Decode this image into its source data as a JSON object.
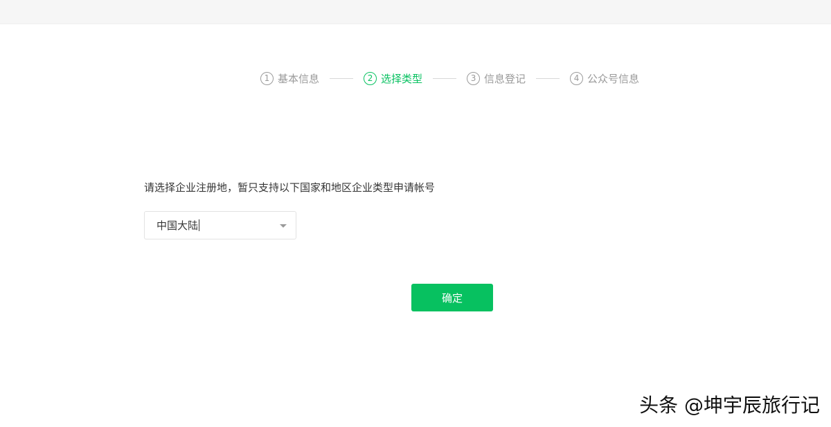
{
  "steps": [
    {
      "num": "1",
      "label": "基本信息",
      "active": false
    },
    {
      "num": "2",
      "label": "选择类型",
      "active": true
    },
    {
      "num": "3",
      "label": "信息登记",
      "active": false
    },
    {
      "num": "4",
      "label": "公众号信息",
      "active": false
    }
  ],
  "form": {
    "prompt": "请选择企业注册地，暂只支持以下国家和地区企业类型申请帐号",
    "region_select_value": "中国大陆",
    "confirm_label": "确定"
  },
  "watermark": {
    "text": "头条 @坤宇辰旅行记"
  },
  "colors": {
    "accent": "#07c160",
    "inactive": "#9a9a9a",
    "text": "#353535"
  }
}
